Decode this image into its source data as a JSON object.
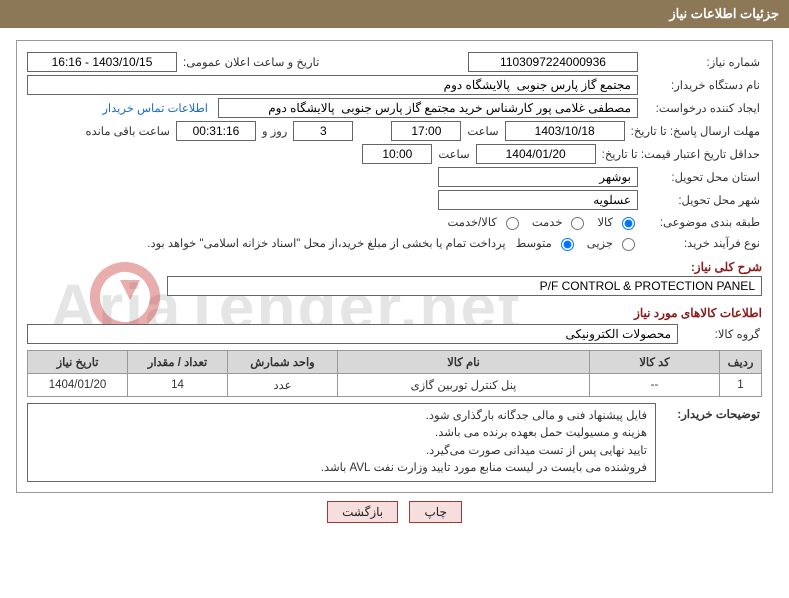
{
  "title": "جزئیات اطلاعات نیاز",
  "labels": {
    "need_no": "شماره نیاز:",
    "announce_dt": "تاریخ و ساعت اعلان عمومی:",
    "buyer_org": "نام دستگاه خریدار:",
    "creator": "ایجاد کننده درخواست:",
    "contact_link": "اطلاعات تماس خریدار",
    "resp_deadline": "مهلت ارسال پاسخ: تا تاریخ:",
    "hour": "ساعت",
    "day_and": "روز و",
    "remain": "ساعت باقی مانده",
    "min_valid": "حداقل تاریخ اعتبار قیمت: تا تاریخ:",
    "deliv_prov": "استان محل تحویل:",
    "deliv_city": "شهر محل تحویل:",
    "subject_class": "طبقه بندی موضوعی:",
    "purchase_type": "نوع فرآیند خرید:",
    "need_desc_head": "شرح کلی نیاز:",
    "items_head": "اطلاعات کالاهای مورد نیاز",
    "item_group": "گروه کالا:",
    "buyer_notes": "توضیحات خریدار:"
  },
  "values": {
    "need_no": "1103097224000936",
    "announce_dt": "1403/10/15 - 16:16",
    "buyer_org": "مجتمع گاز پارس جنوبی  پالایشگاه دوم",
    "creator": "مصطفی غلامی پور کارشناس خرید مجتمع گاز پارس جنوبی  پالایشگاه دوم",
    "resp_date": "1403/10/18",
    "resp_hour": "17:00",
    "days_remain": "3",
    "hours_remain": "00:31:16",
    "min_valid_date": "1404/01/20",
    "min_valid_hour": "10:00",
    "deliv_prov": "بوشهر",
    "deliv_city": "عسلويه",
    "need_desc": "P/F CONTROL & PROTECTION PANEL",
    "item_group": "محصولات الکترونیکی"
  },
  "radios": {
    "subject": {
      "goods": "کالا",
      "service": "خدمت",
      "both": "کالا/خدمت",
      "selected": "goods"
    },
    "purchase": {
      "partial": "جزیی",
      "medium": "متوسط",
      "selected": "medium",
      "note": "پرداخت تمام یا بخشی از مبلغ خرید،از محل \"اسناد خزانه اسلامی\" خواهد بود."
    }
  },
  "table": {
    "headers": [
      "ردیف",
      "کد کالا",
      "نام کالا",
      "واحد شمارش",
      "تعداد / مقدار",
      "تاریخ نیاز"
    ],
    "rows": [
      {
        "idx": "1",
        "code": "--",
        "name": "پنل کنترل توربین گازی",
        "unit": "عدد",
        "qty": "14",
        "date": "1404/01/20"
      }
    ]
  },
  "notes_lines": [
    "فایل پیشنهاد فنی و مالی جدگانه بارگذاری شود.",
    "هزینه و مسیولیت حمل بعهده برنده می باشد.",
    "تایید نهایی پس از تست میدانی صورت می‌گیرد.",
    "فروشنده می بایست در لیست منابع مورد تایید وزارت نفت AVL باشد."
  ],
  "buttons": {
    "print": "چاپ",
    "back": "بازگشت"
  },
  "watermark": "AriaTender.net"
}
